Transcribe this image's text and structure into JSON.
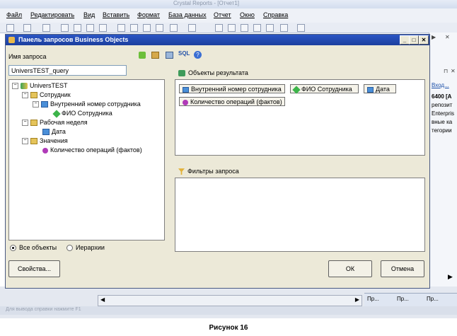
{
  "app": {
    "title": "Crystal Reports - [Отчет1]",
    "menu": [
      "Файл",
      "Редактировать",
      "Вид",
      "Вставить",
      "Формат",
      "База данных",
      "Отчет",
      "Окно",
      "Справка"
    ],
    "right_panel_lines": [
      "Вход...",
      "6400 [А",
      "репозит",
      "Enterpris",
      "вные ка",
      "тегории"
    ],
    "task_tabs": [
      "Пр...",
      "Пр...",
      "Пр..."
    ],
    "status": "Для вывода справки нажмите F1"
  },
  "dialog": {
    "title": "Панель запросов Business Objects",
    "query_name_label": "Имя запроса",
    "query_name_value": "UniversTEST_query",
    "tree": [
      {
        "label": "UniversTEST",
        "icon": "universe-icon",
        "level": 0,
        "expand": "−"
      },
      {
        "label": "Сотрудник",
        "icon": "folder-icon",
        "level": 1,
        "expand": "−"
      },
      {
        "label": "Внутренний номер сотрудника",
        "icon": "dimension-icon",
        "level": 2,
        "expand": "−"
      },
      {
        "label": "ФИО Сотрудника",
        "icon": "detail-icon",
        "level": 3,
        "expand": ""
      },
      {
        "label": "Рабочая неделя",
        "icon": "folder-icon",
        "level": 1,
        "expand": "−"
      },
      {
        "label": "Дата",
        "icon": "dimension-icon",
        "level": 2,
        "expand": ""
      },
      {
        "label": "Значения",
        "icon": "folder-icon",
        "level": 1,
        "expand": "−"
      },
      {
        "label": "Количество операций (фактов)",
        "icon": "measure-icon",
        "level": 2,
        "expand": ""
      }
    ],
    "result_objects_label": "Объекты результата",
    "result_objects": [
      {
        "label": "Внутренний номер сотрудника",
        "icon": "dimension-icon"
      },
      {
        "label": "ФИО Сотрудника",
        "icon": "detail-icon"
      },
      {
        "label": "Дата",
        "icon": "dimension-icon"
      },
      {
        "label": "Количество операций (фактов)",
        "icon": "measure-icon"
      }
    ],
    "filters_label": "Фильтры запроса",
    "radio_all": "Все объекты",
    "radio_hier": "Иерархии",
    "properties_button": "Свойства...",
    "ok_button": "ОК",
    "cancel_button": "Отмена"
  },
  "caption": "Рисунок 16"
}
